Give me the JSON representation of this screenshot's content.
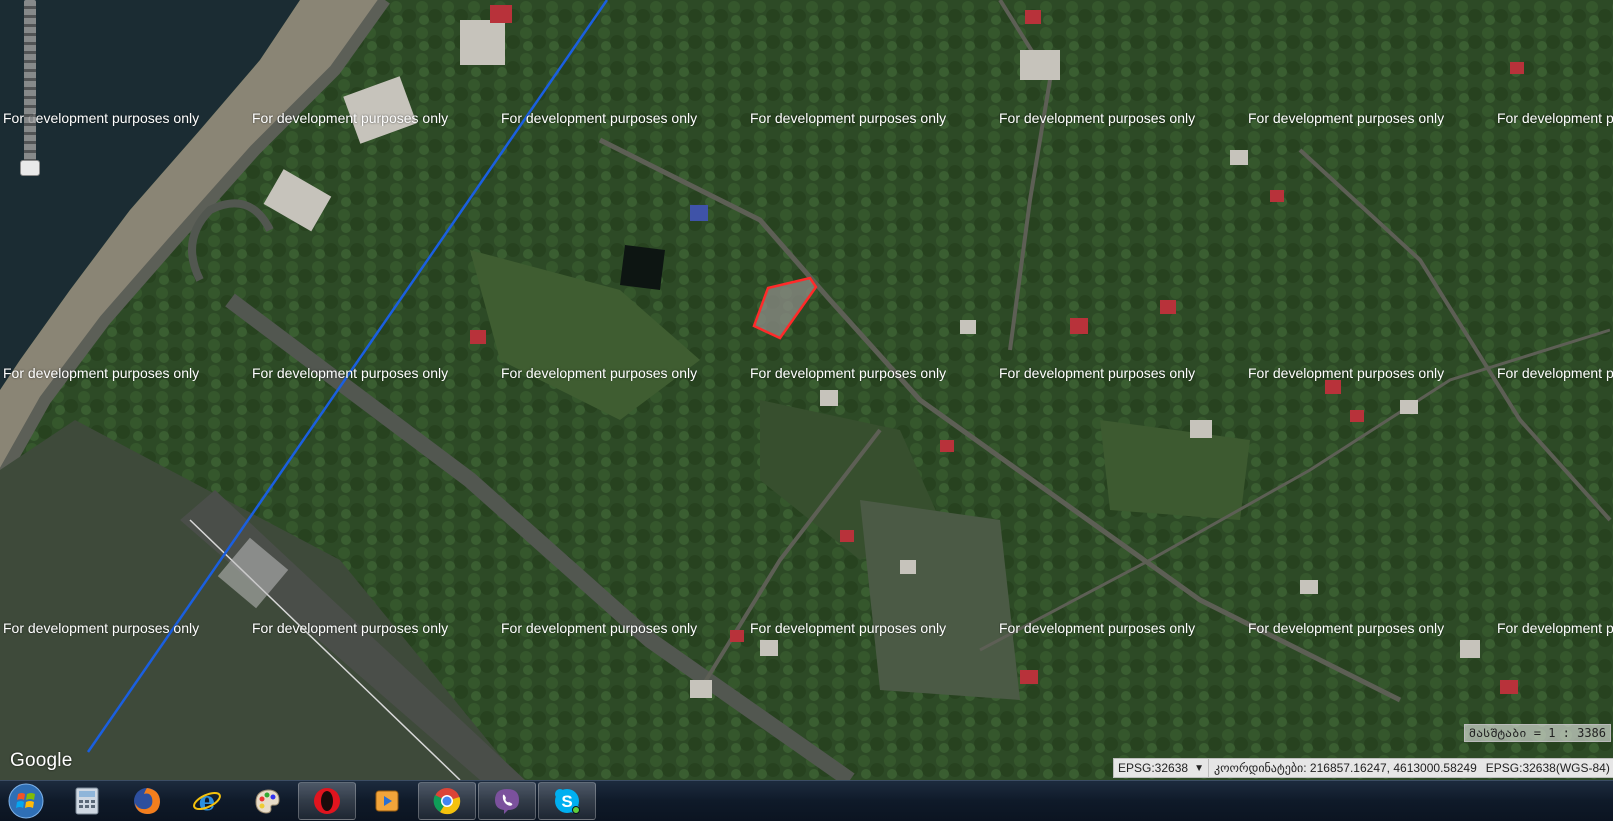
{
  "map": {
    "watermark_text": "For development purposes only",
    "provider_logo": "Google",
    "scale_label": "მასშტაბი = 1 : 3386",
    "parcel_outline_color": "#ff2a2a",
    "route_line_color": "#1a5fe0"
  },
  "status_bar": {
    "crs_select_value": "EPSG:32638",
    "coordinates_label": "კოორდინატები: 216857.16247, 4613000.58249",
    "crs_display": "EPSG:32638(WGS-84)"
  },
  "zoom_slider": {
    "icon": "zoom-slider"
  },
  "taskbar": {
    "start_icon": "windows-start-icon",
    "apps": [
      {
        "name": "calculator",
        "icon": "calculator-icon"
      },
      {
        "name": "firefox",
        "icon": "firefox-icon"
      },
      {
        "name": "internet-explorer",
        "icon": "internet-explorer-icon"
      },
      {
        "name": "paint",
        "icon": "paint-icon"
      },
      {
        "name": "opera",
        "icon": "opera-icon"
      },
      {
        "name": "media-player",
        "icon": "media-player-icon"
      },
      {
        "name": "chrome",
        "icon": "chrome-icon"
      },
      {
        "name": "viber",
        "icon": "viber-icon"
      },
      {
        "name": "skype",
        "icon": "skype-icon"
      }
    ]
  }
}
